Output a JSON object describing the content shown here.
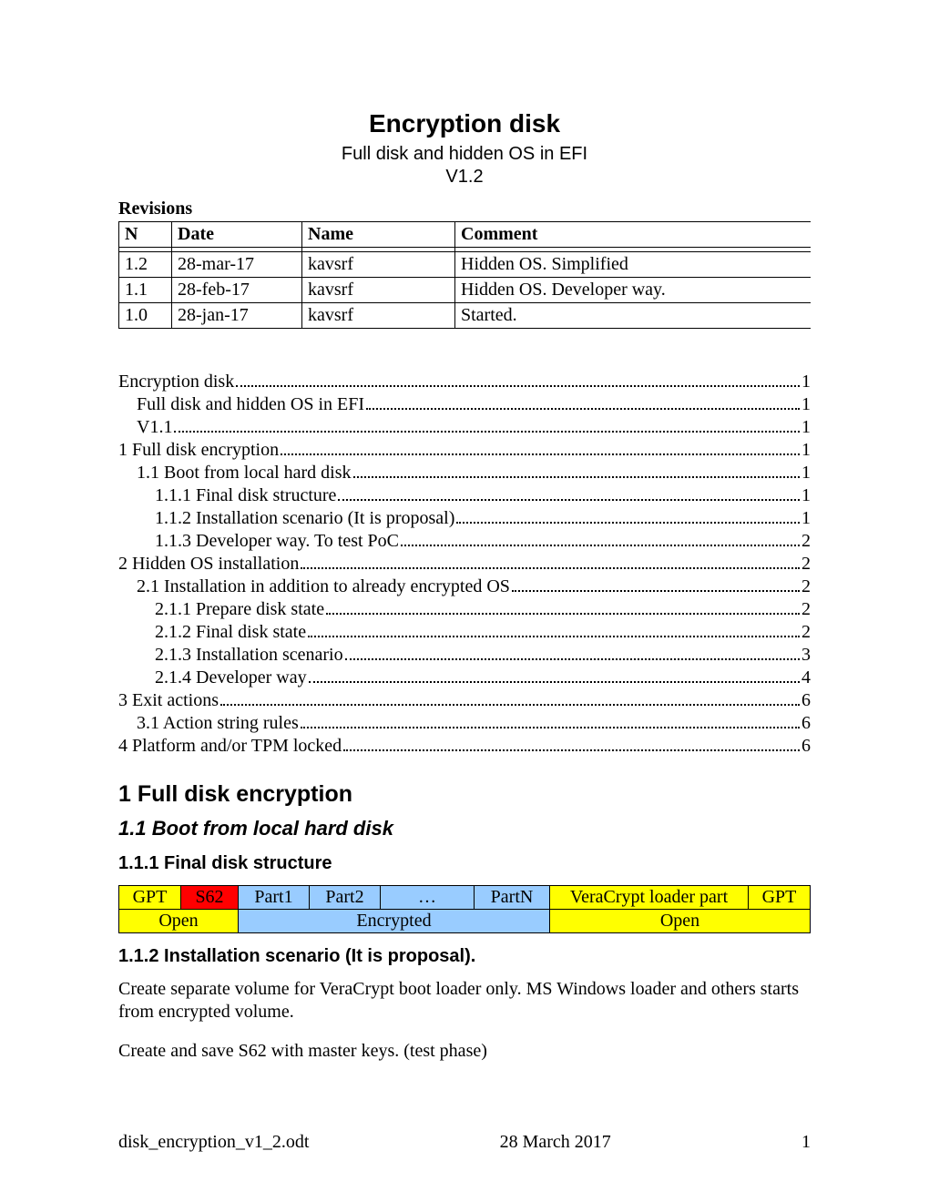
{
  "header": {
    "title": "Encryption disk",
    "subtitle": "Full disk and hidden OS in EFI",
    "version": "V1.2"
  },
  "revisions": {
    "heading": "Revisions",
    "cols": {
      "n": "N",
      "date": "Date",
      "name": "Name",
      "comment": "Comment"
    },
    "rows": [
      {
        "n": "",
        "date": "",
        "name": "",
        "comment": ""
      },
      {
        "n": "1.2",
        "date": "28-mar-17",
        "name": "kavsrf",
        "comment": "Hidden OS. Simplified"
      },
      {
        "n": "1.1",
        "date": "28-feb-17",
        "name": "kavsrf",
        "comment": "Hidden OS. Developer way."
      },
      {
        "n": "1.0",
        "date": "28-jan-17",
        "name": "kavsrf",
        "comment": "Started."
      }
    ]
  },
  "toc": [
    {
      "label": "Encryption disk",
      "page": "1",
      "indent": 0
    },
    {
      "label": "Full disk and hidden OS in EFI",
      "page": "1",
      "indent": 1
    },
    {
      "label": "V1.1",
      "page": "1",
      "indent": 1
    },
    {
      "label": "1 Full disk encryption",
      "page": "1",
      "indent": 0
    },
    {
      "label": "1.1 Boot from local hard disk",
      "page": "1",
      "indent": 1
    },
    {
      "label": "1.1.1 Final disk structure",
      "page": "1",
      "indent": 2
    },
    {
      "label": "1.1.2 Installation scenario (It is proposal)",
      "page": "1",
      "indent": 2
    },
    {
      "label": "1.1.3 Developer way. To test PoC",
      "page": "2",
      "indent": 2
    },
    {
      "label": "2 Hidden OS installation",
      "page": "2",
      "indent": 0
    },
    {
      "label": "2.1 Installation in addition to already encrypted OS",
      "page": "2",
      "indent": 1
    },
    {
      "label": "2.1.1 Prepare disk state",
      "page": "2",
      "indent": 2
    },
    {
      "label": "2.1.2 Final disk state",
      "page": "2",
      "indent": 2
    },
    {
      "label": "2.1.3 Installation scenario",
      "page": "3",
      "indent": 2
    },
    {
      "label": "2.1.4 Developer way",
      "page": "4",
      "indent": 2
    },
    {
      "label": "3 Exit actions",
      "page": "6",
      "indent": 0
    },
    {
      "label": "3.1 Action string rules",
      "page": "6",
      "indent": 1
    },
    {
      "label": "4 Platform and/or TPM locked",
      "page": "6",
      "indent": 0
    }
  ],
  "section1": {
    "h2": "1   Full disk encryption",
    "h3": "1.1   Boot from local hard disk",
    "h4a": "1.1.1  Final disk structure",
    "h4b": "1.1.2  Installation scenario (It is proposal).",
    "para1": "Create separate volume for VeraCrypt boot loader only. MS Windows loader and others starts from encrypted volume.",
    "para2": "Create and save S62 with master keys. (test phase)"
  },
  "disk": {
    "row1": [
      "GPT",
      "S62",
      "Part1",
      "Part2",
      "…",
      "PartN",
      "VeraCrypt loader part",
      "GPT"
    ],
    "row2": [
      "Open",
      "Encrypted",
      "Open"
    ]
  },
  "footer": {
    "left": "disk_encryption_v1_2.odt",
    "center": "28 March 2017",
    "right": "1"
  }
}
